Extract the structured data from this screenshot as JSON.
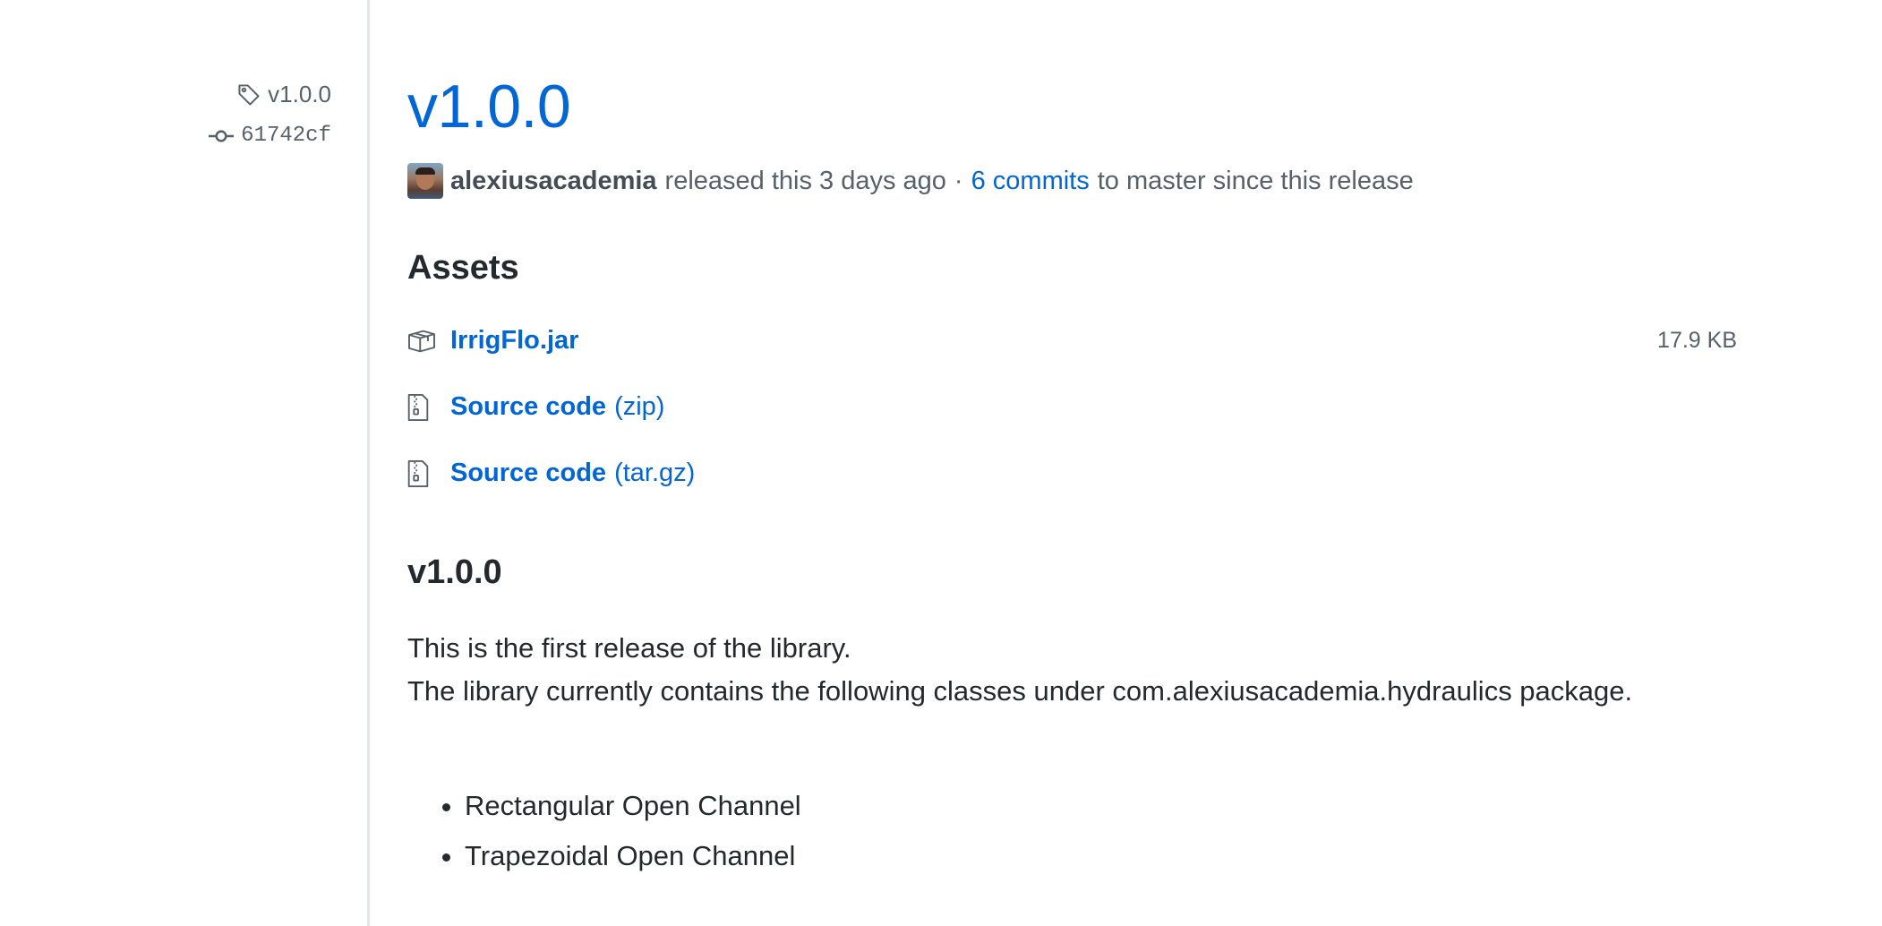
{
  "sidebar": {
    "tag": "v1.0.0",
    "commit": "61742cf"
  },
  "release": {
    "title": "v1.0.0",
    "author": "alexiusacademia",
    "released_text": "released this 3 days ago",
    "separator": "·",
    "commits_link": "6 commits",
    "commits_suffix": "to master since this release"
  },
  "assets": {
    "heading": "Assets",
    "items": [
      {
        "name": "IrrigFlo.jar",
        "ext": "",
        "size": "17.9 KB",
        "icon": "package-icon"
      },
      {
        "name": "Source code",
        "ext": "(zip)",
        "size": "",
        "icon": "file-zip-icon"
      },
      {
        "name": "Source code",
        "ext": "(tar.gz)",
        "size": "",
        "icon": "file-zip-icon"
      }
    ]
  },
  "notes": {
    "heading": "v1.0.0",
    "line1": "This is the first release of the library.",
    "line2": "The library currently contains the following classes under com.alexiusacademia.hydraulics package.",
    "list": [
      "Rectangular Open Channel",
      "Trapezoidal Open Channel"
    ]
  },
  "colors": {
    "link": "#0366d6",
    "text": "#24292e",
    "muted": "#586069",
    "divider": "#e1e4e8"
  }
}
